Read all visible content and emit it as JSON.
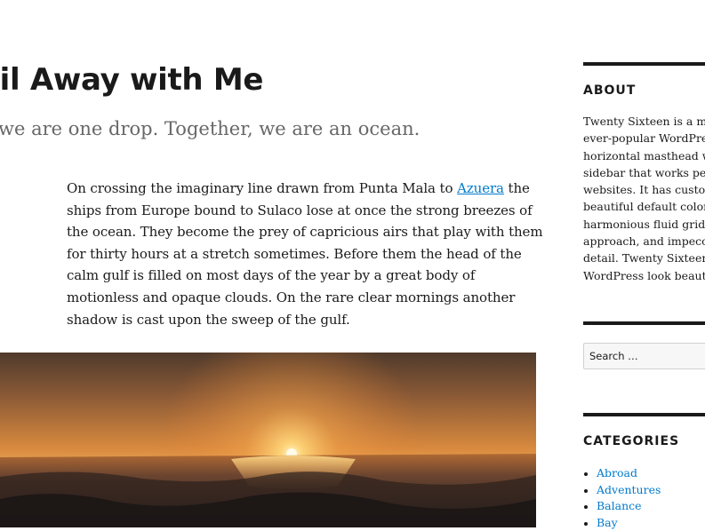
{
  "post": {
    "title": "ail Away with Me",
    "subtitle": "we are one drop. Together, we are an ocean.",
    "body_before_link": "On crossing the imaginary line drawn from Punta Mala to ",
    "body_link": "Azuera",
    "body_after_link": " the ships from Europe bound to Sulaco lose at once the strong breezes of the ocean. They become the prey of capricious airs that play with them for thirty hours at a stretch sometimes. Before them the head of the calm gulf is filled on most days of the year by a great body of motionless and opaque clouds. On the rare clear mornings another shadow is cast upon the sweep of the gulf."
  },
  "sidebar": {
    "about": {
      "title": "ABOUT",
      "lines": [
        "Twenty Sixteen is a mod",
        "ever-popular WordPress",
        "horizontal masthead wit",
        "sidebar that works perfe",
        "websites. It has custom",
        "beautiful default color s",
        "harmonious fluid grid us",
        "approach, and impeccab",
        "detail. Twenty Sixteen w",
        "WordPress look beautifu"
      ]
    },
    "search": {
      "placeholder": "Search …"
    },
    "categories": {
      "title": "CATEGORIES",
      "items": [
        "Abroad",
        "Adventures",
        "Balance",
        "Bay"
      ]
    }
  },
  "colors": {
    "link": "#007acc",
    "text": "#1a1a1a",
    "subtitle": "#686868"
  }
}
